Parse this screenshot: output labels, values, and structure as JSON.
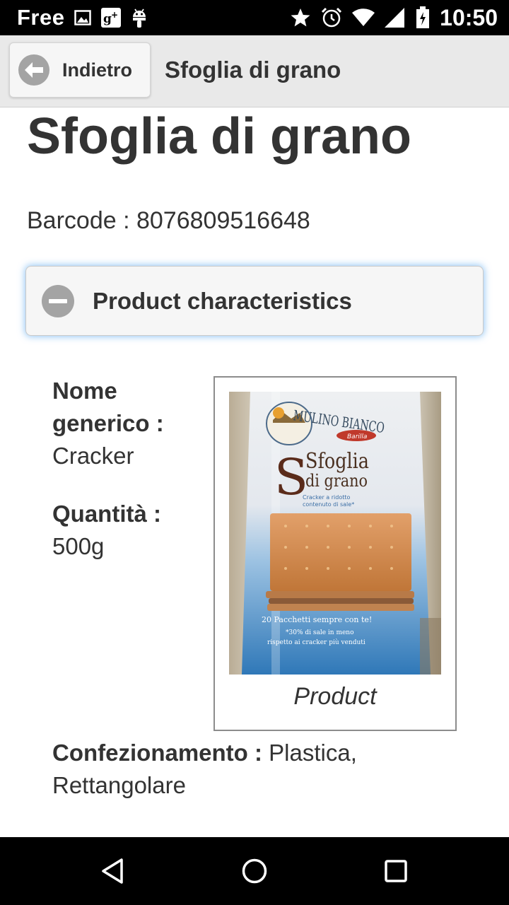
{
  "status_bar": {
    "carrier": "Free",
    "time": "10:50",
    "left_icons": [
      "image-icon",
      "google-plus-icon",
      "android-icon"
    ],
    "right_icons": [
      "star-icon",
      "alarm-icon",
      "wifi-icon",
      "signal-icon",
      "battery-icon"
    ]
  },
  "header": {
    "back_label": "Indietro",
    "title": "Sfoglia di grano",
    "back_icon": "arrow-left-icon"
  },
  "product": {
    "name": "Sfoglia di grano",
    "barcode_label": "Barcode",
    "barcode_separator": " : ",
    "barcode_value": "8076809516648"
  },
  "characteristics": {
    "section_label": "Product characteristics",
    "toggle_icon": "minus-circle-icon",
    "fields": {
      "nome_generico": {
        "label": "Nome generico :",
        "value": "Cracker"
      },
      "quantita": {
        "label": "Quantità :",
        "value": "500g"
      },
      "confezionamento": {
        "label": "Confezionamento :",
        "value": "Plastica, Rettangolare"
      }
    },
    "image_caption": "Product"
  },
  "photo_text": {
    "brand": "MULINO BIANCO",
    "maker": "Barilla",
    "line1": "Sfoglia",
    "line2": "di grano",
    "sub1": "Cracker a ridotto",
    "sub2": "contenuto di sale*",
    "bottom1": "20 Pacchetti sempre con te!",
    "bottom2": "*30% di sale in meno",
    "bottom3": "rispetto ai cracker più venduti"
  },
  "nav_bar": {
    "icons": [
      "back-triangle-icon",
      "home-circle-icon",
      "recents-square-icon"
    ]
  },
  "colors": {
    "status_bar_bg": "#000000",
    "header_bg": "#e9e9e9",
    "text": "#333333",
    "focus_glow": "#3898ec",
    "icon_gray": "#a4a4a4"
  }
}
